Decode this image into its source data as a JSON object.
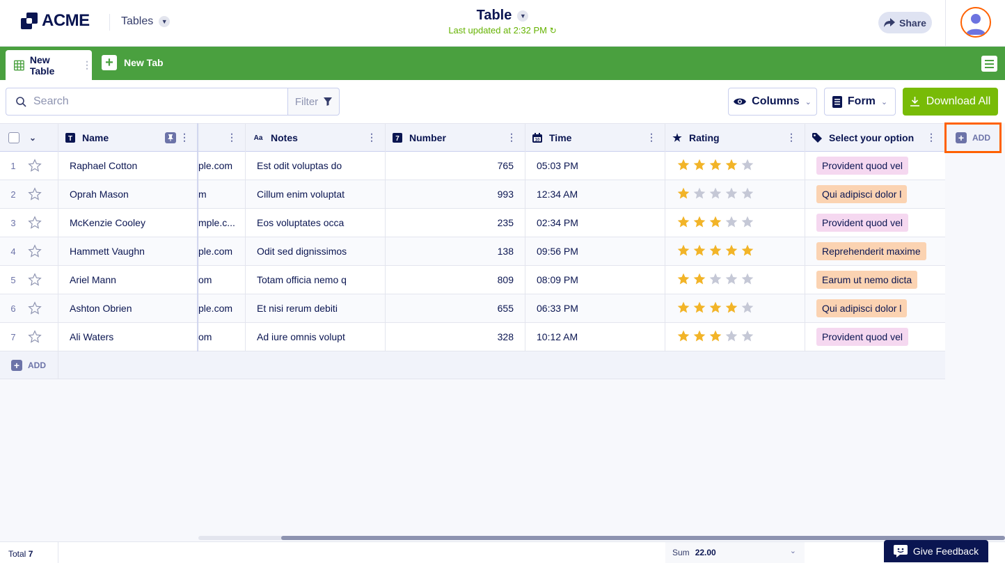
{
  "header": {
    "logo_text": "ACME",
    "app_section": "Tables",
    "title": "Table",
    "last_updated": "Last updated at 2:32 PM",
    "share_label": "Share"
  },
  "tabs": {
    "active_label": "New Table",
    "new_tab_label": "New Tab"
  },
  "toolbar": {
    "search_placeholder": "Search",
    "filter_label": "Filter",
    "columns_label": "Columns",
    "form_label": "Form",
    "download_label": "Download All"
  },
  "columns": {
    "name": "Name",
    "notes": "Notes",
    "number": "Number",
    "time": "Time",
    "rating": "Rating",
    "select": "Select your option",
    "add_label": "ADD"
  },
  "rows": [
    {
      "n": "1",
      "name": "Raphael Cotton",
      "email": "ple.com",
      "notes": "Est odit voluptas do",
      "number": "765",
      "time": "05:03 PM",
      "rating": 4,
      "option": "Provident quod vel",
      "option_color": "pink"
    },
    {
      "n": "2",
      "name": "Oprah Mason",
      "email": "m",
      "notes": "Cillum enim voluptat",
      "number": "993",
      "time": "12:34 AM",
      "rating": 1,
      "option": "Qui adipisci dolor l",
      "option_color": "orange"
    },
    {
      "n": "3",
      "name": "McKenzie Cooley",
      "email": "mple.c...",
      "notes": "Eos voluptates occa",
      "number": "235",
      "time": "02:34 PM",
      "rating": 3,
      "option": "Provident quod vel",
      "option_color": "pink"
    },
    {
      "n": "4",
      "name": "Hammett Vaughn",
      "email": "ple.com",
      "notes": "Odit sed dignissimos",
      "number": "138",
      "time": "09:56 PM",
      "rating": 5,
      "option": "Reprehenderit maxime",
      "option_color": "orange"
    },
    {
      "n": "5",
      "name": "Ariel Mann",
      "email": "om",
      "notes": "Totam officia nemo q",
      "number": "809",
      "time": "08:09 PM",
      "rating": 2,
      "option": "Earum ut nemo dicta",
      "option_color": "orange"
    },
    {
      "n": "6",
      "name": "Ashton Obrien",
      "email": "ple.com",
      "notes": "Et nisi rerum debiti",
      "number": "655",
      "time": "06:33 PM",
      "rating": 4,
      "option": "Qui adipisci dolor l",
      "option_color": "orange"
    },
    {
      "n": "7",
      "name": "Ali Waters",
      "email": "om",
      "notes": "Ad iure omnis volupt",
      "number": "328",
      "time": "10:12 AM",
      "rating": 3,
      "option": "Provident quod vel",
      "option_color": "pink"
    }
  ],
  "add_row_label": "ADD",
  "footer": {
    "total_label": "Total",
    "total_value": "7",
    "sum_label": "Sum",
    "sum_value": "22.00",
    "feedback_label": "Give Feedback"
  },
  "colors": {
    "brand_green": "#4aa03f",
    "download_green": "#78bb07",
    "navy": "#0a1551",
    "highlight": "#ff6100",
    "star_on": "#f2b428",
    "star_off": "#c5c8d6"
  }
}
